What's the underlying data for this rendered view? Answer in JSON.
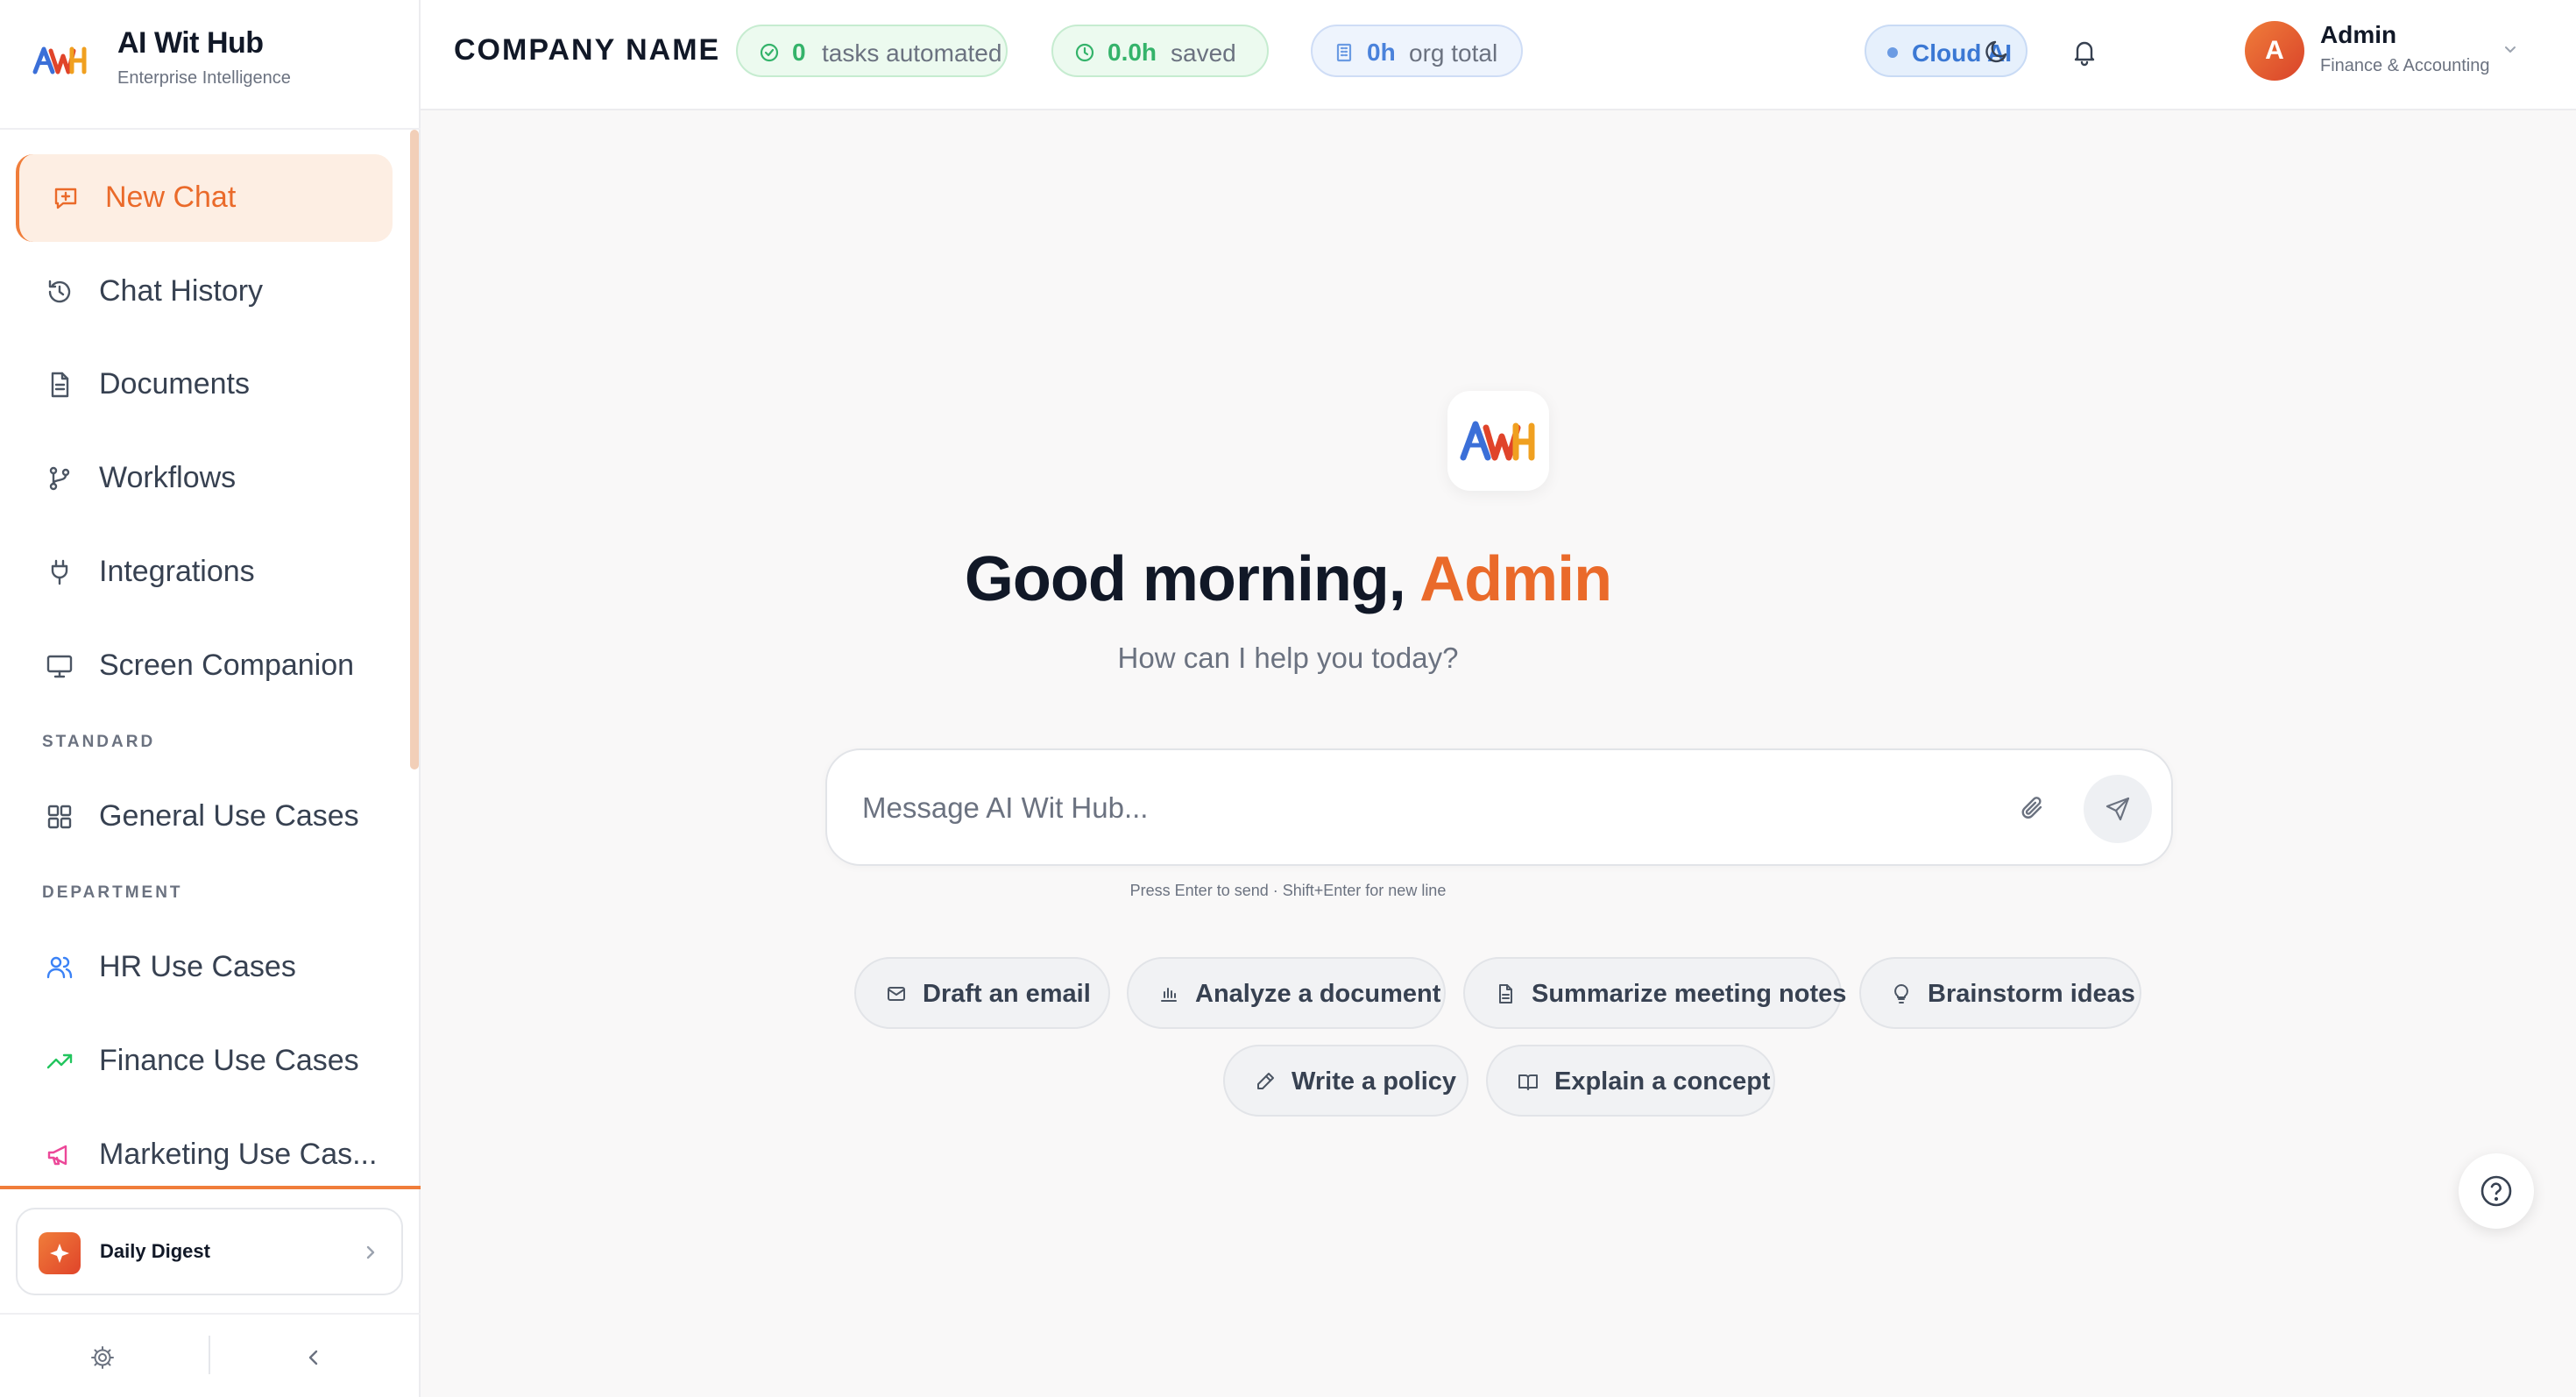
{
  "brand": {
    "title": "AI Wit Hub",
    "subtitle": "Enterprise Intelligence",
    "logo_text": "AWH"
  },
  "sidebar": {
    "items": [
      {
        "label": "New Chat",
        "icon": "chat-plus-icon",
        "active": true
      },
      {
        "label": "Chat History",
        "icon": "history-icon"
      },
      {
        "label": "Documents",
        "icon": "document-icon"
      },
      {
        "label": "Workflows",
        "icon": "git-branch-icon"
      },
      {
        "label": "Integrations",
        "icon": "plug-icon"
      },
      {
        "label": "Screen Companion",
        "icon": "monitor-icon"
      }
    ],
    "sections": [
      {
        "title": "STANDARD",
        "items": [
          {
            "label": "General Use Cases",
            "icon": "grid-icon"
          }
        ]
      },
      {
        "title": "DEPARTMENT",
        "items": [
          {
            "label": "HR Use Cases",
            "icon": "users-icon",
            "color": "#3b82f6"
          },
          {
            "label": "Finance Use Cases",
            "icon": "trending-up-icon",
            "color": "#22c55e"
          },
          {
            "label": "Marketing Use Cas...",
            "icon": "megaphone-icon",
            "color": "#ec4899"
          }
        ]
      }
    ],
    "digest_label": "Daily Digest"
  },
  "header": {
    "company": "COMPANY NAME",
    "stats": [
      {
        "value": "0",
        "label": "tasks automated",
        "icon": "check-circle-icon"
      },
      {
        "value": "0.0h",
        "label": "saved",
        "icon": "clock-icon"
      },
      {
        "value": "0h",
        "label": "org total",
        "icon": "building-icon"
      }
    ],
    "mode": "Cloud AI",
    "user": {
      "initial": "A",
      "name": "Admin",
      "role": "Finance & Accounting"
    }
  },
  "main": {
    "greeting": "Good morning,",
    "greeting_name": "Admin",
    "subtitle": "How can I help you today?",
    "input_placeholder": "Message AI Wit Hub...",
    "hint": "Press Enter to send · Shift+Enter for new line",
    "chips": [
      {
        "label": "Draft an email",
        "icon": "mail-icon"
      },
      {
        "label": "Analyze a document",
        "icon": "bar-chart-icon"
      },
      {
        "label": "Summarize meeting notes",
        "icon": "file-text-icon"
      },
      {
        "label": "Brainstorm ideas",
        "icon": "lightbulb-icon"
      },
      {
        "label": "Write a policy",
        "icon": "pen-icon"
      },
      {
        "label": "Explain a concept",
        "icon": "book-icon"
      }
    ]
  },
  "colors": {
    "accent": "#ea6a2a",
    "accent_bg": "#fdeee3",
    "success": "#34b36a",
    "info": "#4a82db"
  }
}
